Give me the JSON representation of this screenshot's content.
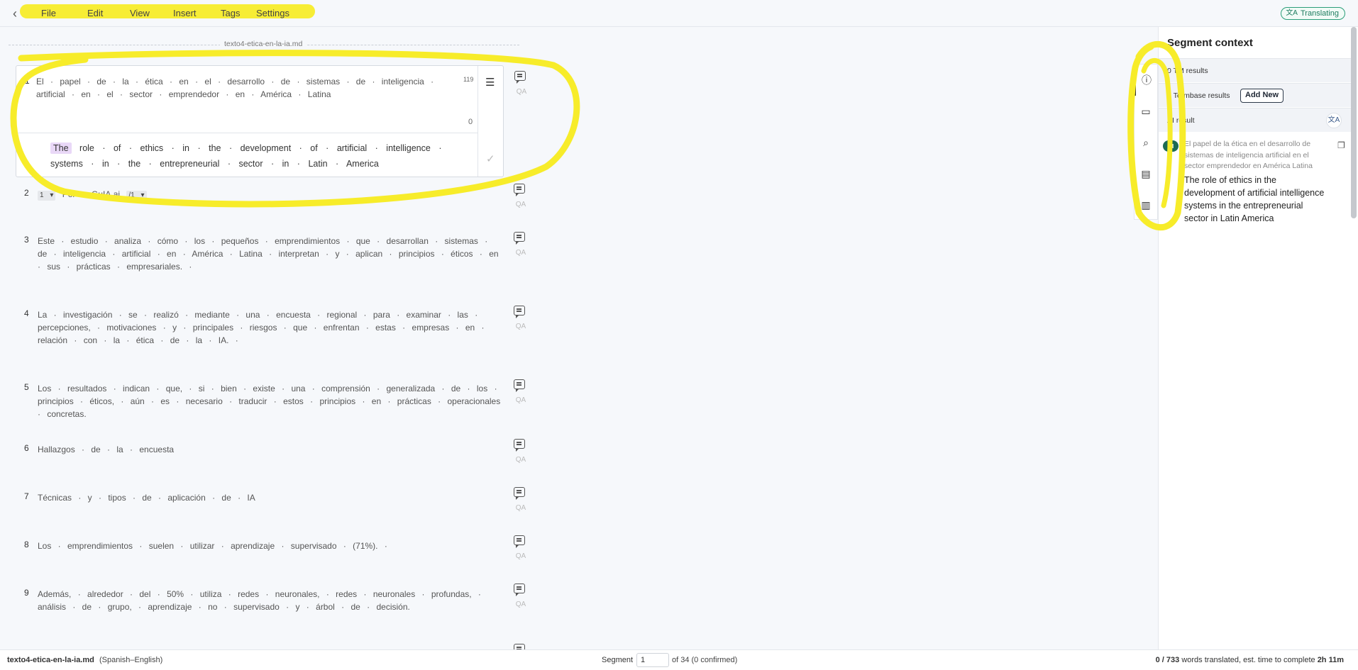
{
  "app": {
    "menu": [
      "File",
      "Edit",
      "View",
      "Insert",
      "Tags",
      "Settings"
    ],
    "status": "Translating"
  },
  "file": {
    "name": "texto4-etica-en-la-ia.md"
  },
  "active_segment": {
    "number": "1",
    "source": "El · papel · de · la · ética · en · el · desarrollo · de · sistemas · de · inteligencia · artificial · en · el · sector · emprendedor · en · América · Latina",
    "char_count": "119",
    "zero": "0",
    "target_first": "The",
    "target_rest": "role · of · ethics · in · the · development · of · artificial · intelligence · systems · in · the · entrepreneurial · sector · in · Latin · America"
  },
  "segments": [
    {
      "num": "2",
      "tag1": "1 ▾",
      "text": "Por · GuIA.ai",
      "tag2": "/1 ▾"
    },
    {
      "num": "3",
      "text": "Este · estudio · analiza · cómo · los · pequeños · emprendimientos · que · desarrollan · sistemas · de · inteligencia · artificial · en · América · Latina · interpretan · y · aplican · principios · éticos · en · sus · prácticas · empresariales. ·"
    },
    {
      "num": "4",
      "text": "La · investigación · se · realizó · mediante · una · encuesta · regional · para · examinar · las · percepciones, · motivaciones · y · principales · riesgos · que · enfrentan · estas · empresas · en · relación · con · la · ética · de · la · IA. ·"
    },
    {
      "num": "5",
      "text": "Los · resultados · indican · que, · si · bien · existe · una · comprensión · generalizada · de · los · principios · éticos, · aún · es · necesario · traducir · estos · principios · en · prácticas · operacionales · concretas."
    },
    {
      "num": "6",
      "text": "Hallazgos · de · la · encuesta"
    },
    {
      "num": "7",
      "text": "Técnicas · y · tipos · de · aplicación · de · IA"
    },
    {
      "num": "8",
      "text": "Los · emprendimientos · suelen · utilizar · aprendizaje · supervisado · (71%). ·"
    },
    {
      "num": "9",
      "text": "Además, · alrededor · del · 50% · utiliza · redes · neuronales, · redes · neuronales · profundas, · análisis · de · grupo, · aprendizaje · no · supervisado · y · árbol · de · decisión."
    }
  ],
  "qa_label": "QA",
  "panel": {
    "title": "Segment context",
    "tm_results": "0 TM results",
    "termbase_results": "0 Termbase results",
    "add_new": "Add New",
    "ai_result": "AI result",
    "ai_badge": "AI",
    "ai_source": "El papel de la ética en el desarrollo de sistemas de inteligencia artificial en el sector emprendedor en América Latina",
    "ai_target": "The role of ethics in the development of artificial intelligence systems in the entrepreneurial sector in Latin America"
  },
  "footer": {
    "file": "texto4-etica-en-la-ia.md",
    "language": "(Spanish–English)",
    "segment_label": "Segment",
    "segment_value": "1",
    "of_label": "of 34 (0 confirmed)",
    "words": "0 / 733",
    "words_rest": " words translated, est. time to complete ",
    "eta": "2h 11m"
  },
  "colors": {
    "accent_green": "#1d6b53",
    "highlight_yellow": "#f7ec2a",
    "target_highlight": "#e9d8f7"
  }
}
